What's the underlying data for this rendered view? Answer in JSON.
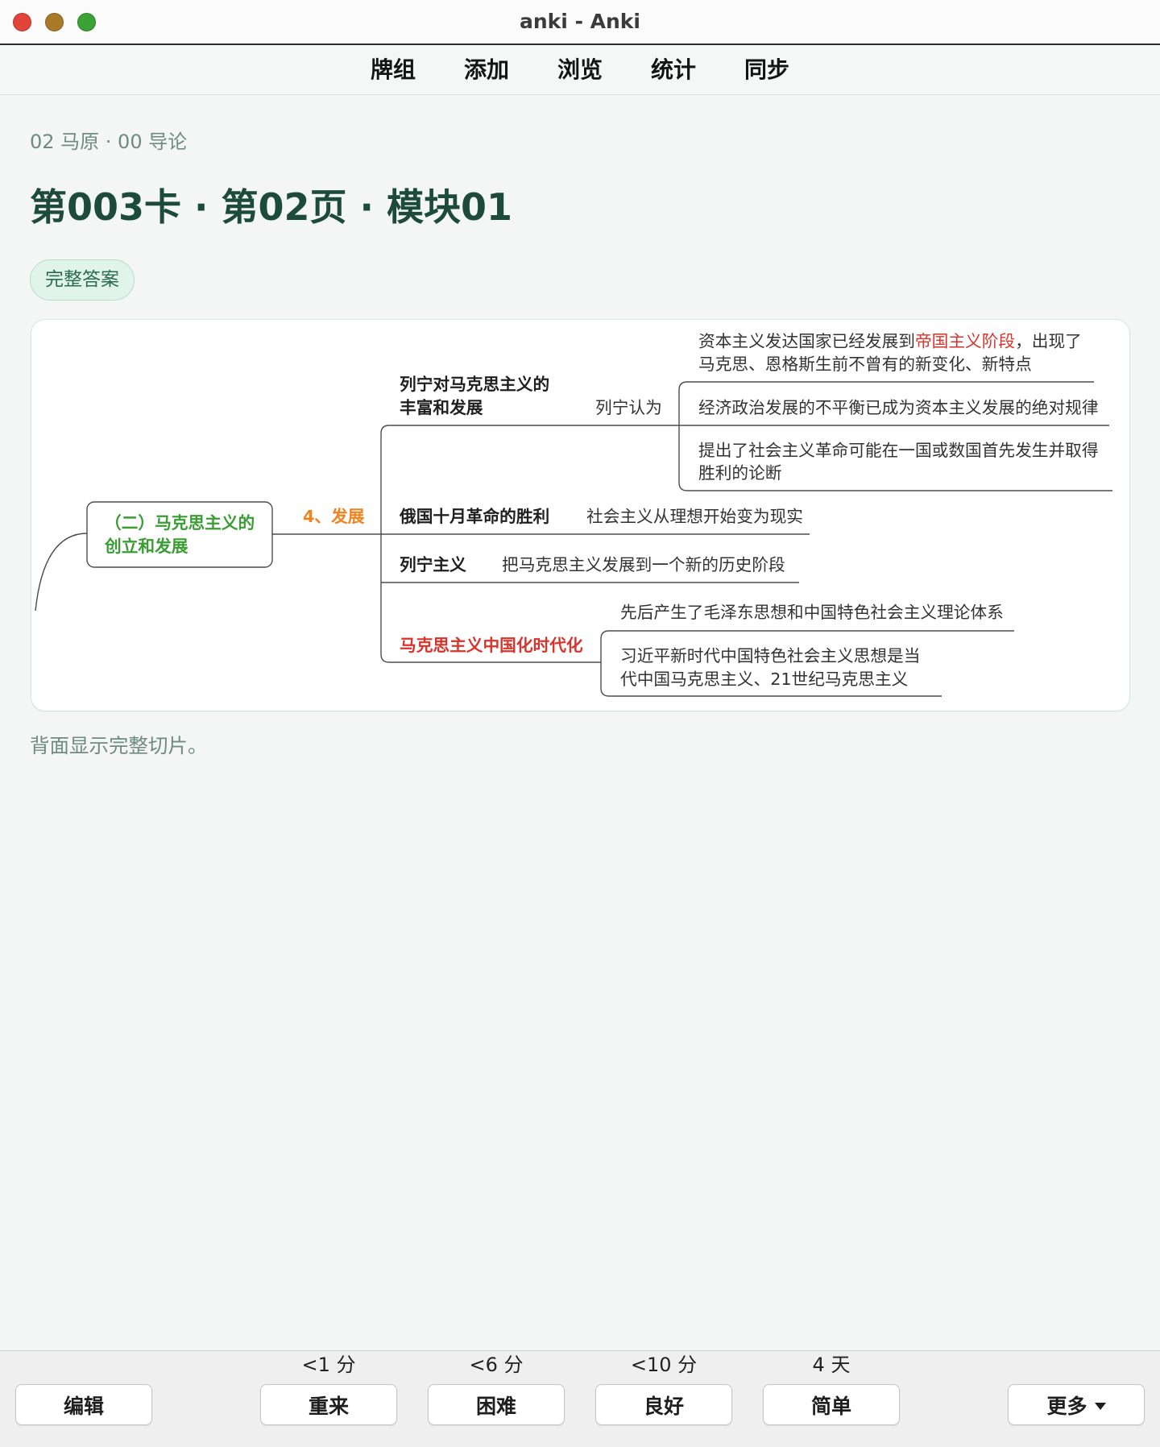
{
  "window": {
    "title": "anki - Anki",
    "controls": {
      "close": "close-icon",
      "minimize": "minimize-icon",
      "zoom": "zoom-icon"
    }
  },
  "toolbar": {
    "items": [
      {
        "label": "牌组"
      },
      {
        "label": "添加"
      },
      {
        "label": "浏览"
      },
      {
        "label": "统计"
      },
      {
        "label": "同步"
      }
    ]
  },
  "review": {
    "deck_path": "02 马原 · 00 导论",
    "card_title": "第003卡 · 第02页 · 模块01",
    "tag": "完整答案",
    "footnote": "背面显示完整切片。",
    "mindmap": {
      "root": [
        "（二）马克思主义的",
        "创立和发展"
      ],
      "topic": "4、发展",
      "branches": [
        {
          "title": [
            "列宁对马克思主义的",
            "丰富和发展"
          ],
          "relation": "列宁认为",
          "points": [
            {
              "line1": {
                "before": "资本主义发达国家已经发展到",
                "highlight": "帝国主义阶段",
                "after": "，出现了"
              },
              "line2": "马克思、恩格斯生前不曾有的新变化、新特点"
            },
            {
              "line1": "经济政治发展的不平衡已成为资本主义发展的绝对规律"
            },
            {
              "line1": "提出了社会主义革命可能在一国或数国首先发生并取得",
              "line2": "胜利的论断"
            }
          ]
        },
        {
          "title": [
            "俄国十月革命的胜利"
          ],
          "points": [
            {
              "line1": "社会主义从理想开始变为现实"
            }
          ]
        },
        {
          "title": [
            "列宁主义"
          ],
          "points": [
            {
              "line1": "把马克思主义发展到一个新的历史阶段"
            }
          ]
        },
        {
          "title": [
            "马克思主义中国化时代化"
          ],
          "points": [
            {
              "line1": "先后产生了毛泽东思想和中国特色社会主义理论体系"
            },
            {
              "line1": "习近平新时代中国特色社会主义思想是当",
              "line2": "代中国马克思主义、21世纪马克思主义"
            }
          ]
        }
      ]
    }
  },
  "answer_bar": {
    "edit": {
      "label": "编辑"
    },
    "ratings": [
      {
        "label": "重来",
        "interval": "<1 分"
      },
      {
        "label": "困难",
        "interval": "<6 分"
      },
      {
        "label": "良好",
        "interval": "<10 分"
      },
      {
        "label": "简单",
        "interval": "4 天"
      }
    ],
    "more": {
      "label": "更多",
      "icon": "caret-down-icon"
    }
  },
  "colors": {
    "heading": "#1d4b3b",
    "muted_text": "#6e8b81",
    "root_green": "#3a9d34",
    "topic_orange": "#ef8320",
    "highlight_red": "#d9332c",
    "tag_bg": "#e1f4ec",
    "tag_border": "#b4dcc9",
    "tag_text": "#2b6b55",
    "edge": "#4d4d4d"
  }
}
